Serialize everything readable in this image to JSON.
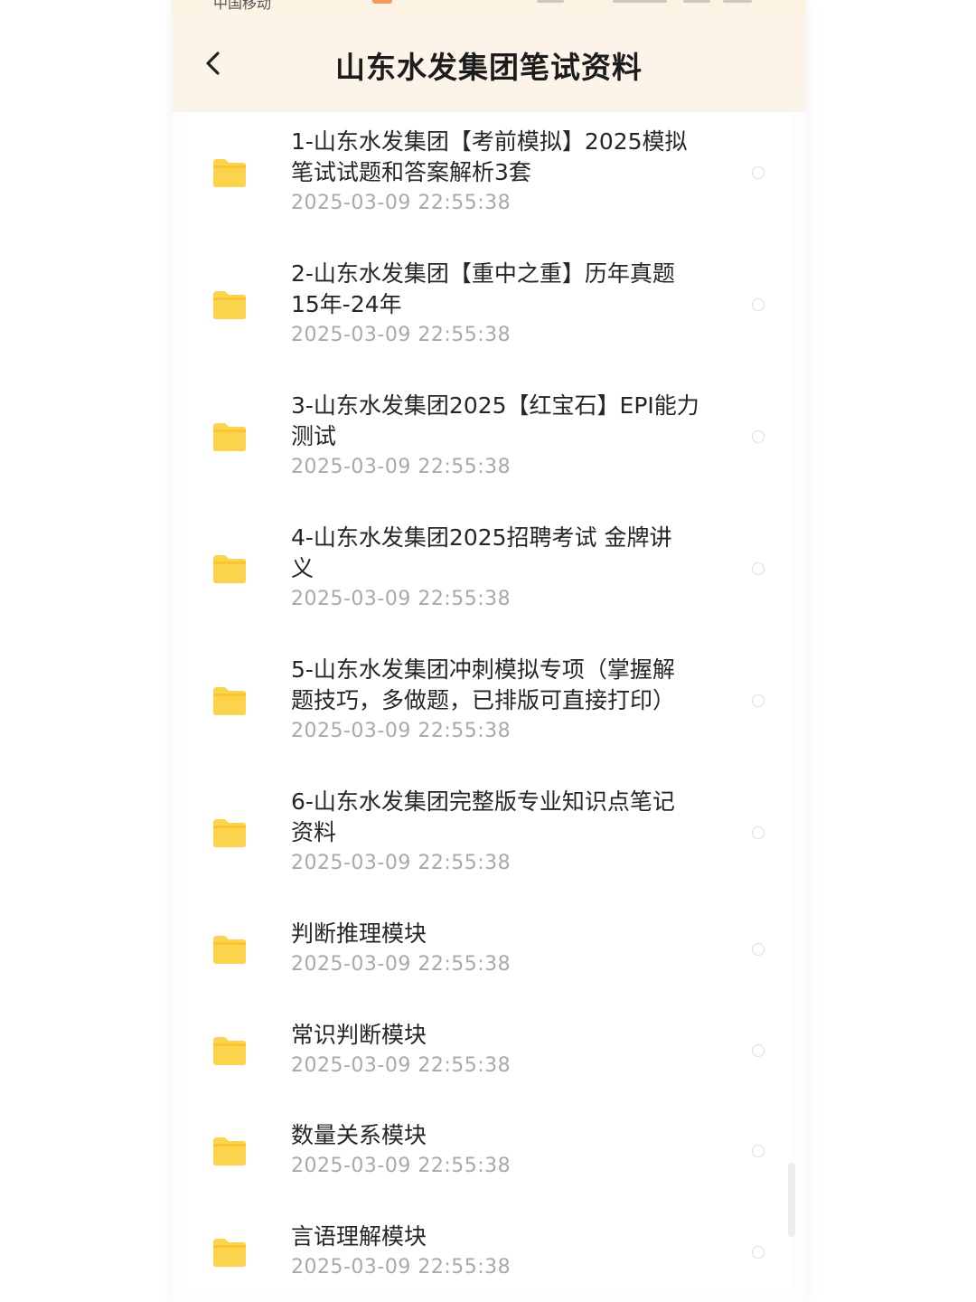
{
  "status_bar": {
    "carrier": "中国移动"
  },
  "header": {
    "title": "山东水发集团笔试资料",
    "back_icon": "chevron-left-icon"
  },
  "colors": {
    "header_bg": "#fdf4e7",
    "folder": "#fcd34d",
    "title_text": "#262626",
    "date_text": "#a9a9a9"
  },
  "files": [
    {
      "title_lines": [
        "1-山东水发集团【考前模拟】2025模拟",
        "笔试试题和答案解析3套"
      ],
      "date": "2025-03-09  22:55:38",
      "icon": "folder-icon"
    },
    {
      "title_lines": [
        "2-山东水发集团【重中之重】历年真题",
        "15年-24年"
      ],
      "date": "2025-03-09  22:55:38",
      "icon": "folder-icon"
    },
    {
      "title_lines": [
        "3-山东水发集团2025【红宝石】EPI能力",
        "测试"
      ],
      "date": "2025-03-09  22:55:38",
      "icon": "folder-icon"
    },
    {
      "title_lines": [
        "4-山东水发集团2025招聘考试 金牌讲",
        "义"
      ],
      "date": "2025-03-09  22:55:38",
      "icon": "folder-icon"
    },
    {
      "title_lines": [
        "5-山东水发集团冲刺模拟专项（掌握解",
        "题技巧，多做题，已排版可直接打印）"
      ],
      "date": "2025-03-09  22:55:38",
      "icon": "folder-icon"
    },
    {
      "title_lines": [
        "6-山东水发集团完整版专业知识点笔记",
        "资料"
      ],
      "date": "2025-03-09  22:55:38",
      "icon": "folder-icon"
    },
    {
      "title_lines": [
        "判断推理模块"
      ],
      "date": "2025-03-09  22:55:38",
      "icon": "folder-icon"
    },
    {
      "title_lines": [
        "常识判断模块"
      ],
      "date": "2025-03-09  22:55:38",
      "icon": "folder-icon"
    },
    {
      "title_lines": [
        "数量关系模块"
      ],
      "date": "2025-03-09  22:55:38",
      "icon": "folder-icon"
    },
    {
      "title_lines": [
        "言语理解模块"
      ],
      "date": "2025-03-09  22:55:38",
      "icon": "folder-icon"
    }
  ]
}
